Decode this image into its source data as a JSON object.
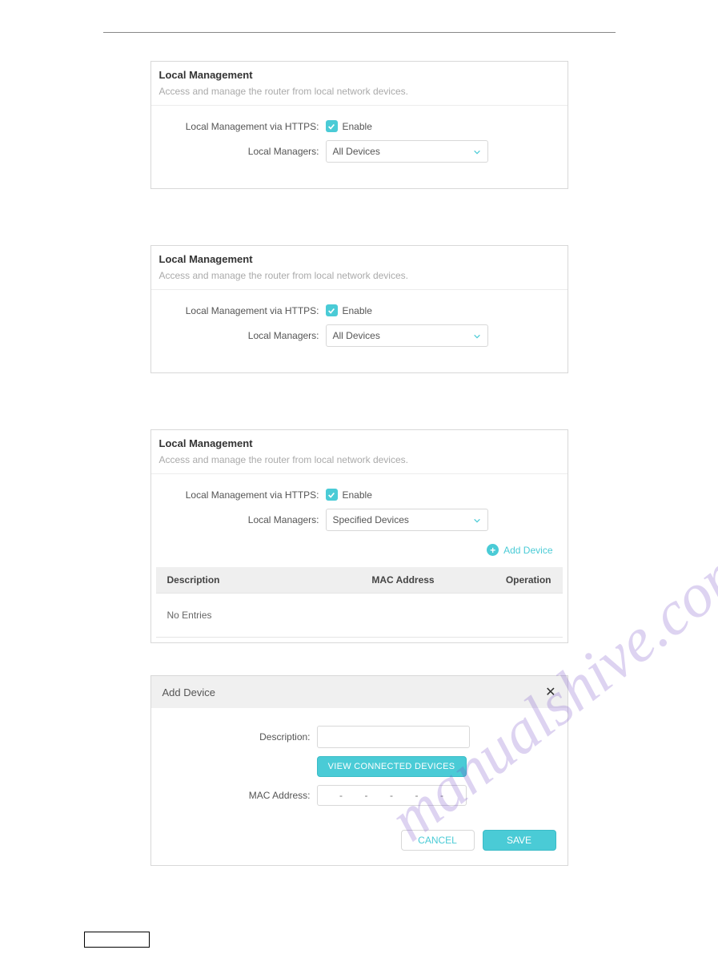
{
  "watermark": "manualshive.com",
  "panel1": {
    "title": "Local Management",
    "subtitle": "Access and manage the router from local network devices.",
    "httpsLabel": "Local Management via HTTPS:",
    "enable": "Enable",
    "managersLabel": "Local Managers:",
    "managersValue": "All Devices"
  },
  "panel2": {
    "title": "Local Management",
    "subtitle": "Access and manage the router from local network devices.",
    "httpsLabel": "Local Management via HTTPS:",
    "enable": "Enable",
    "managersLabel": "Local Managers:",
    "managersValue": "All Devices"
  },
  "panel3": {
    "title": "Local Management",
    "subtitle": "Access and manage the router from local network devices.",
    "httpsLabel": "Local Management via HTTPS:",
    "enable": "Enable",
    "managersLabel": "Local Managers:",
    "managersValue": "Specified Devices",
    "addDevice": "Add Device",
    "col1": "Description",
    "col2": "MAC Address",
    "col3": "Operation",
    "noEntries": "No Entries"
  },
  "dialog": {
    "title": "Add Device",
    "descLabel": "Description:",
    "viewConnected": "VIEW CONNECTED DEVICES",
    "macLabel": "MAC Address:",
    "macSep": "-",
    "cancel": "CANCEL",
    "save": "SAVE"
  }
}
